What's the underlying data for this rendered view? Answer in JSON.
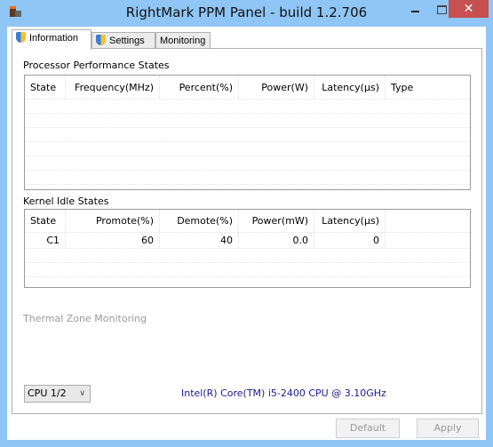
{
  "window": {
    "title": "RightMark PPM Panel - build 1.2.706",
    "close_glyph": "✕"
  },
  "tabs": [
    {
      "label": "Information",
      "icon": "shield-icon"
    },
    {
      "label": "Settings",
      "icon": "shield-icon"
    },
    {
      "label": "Monitoring"
    }
  ],
  "pps": {
    "title": "Processor Performance States",
    "columns": [
      "State",
      "Frequency(MHz)",
      "Percent(%)",
      "Power(W)",
      "Latency(µs)",
      "Type"
    ]
  },
  "kis": {
    "title": "Kernel Idle States",
    "columns": [
      "State",
      "Promote(%)",
      "Demote(%)",
      "Power(mW)",
      "Latency(µs)",
      ""
    ],
    "rows": [
      [
        "C1",
        "60",
        "40",
        "0.0",
        "0",
        ""
      ]
    ]
  },
  "thermal": {
    "title": "Thermal Zone Monitoring"
  },
  "cpu_select": {
    "value": "CPU 1/2"
  },
  "cpu_name": "Intel(R) Core(TM) i5-2400 CPU @ 3.10GHz",
  "buttons": {
    "default": "Default",
    "apply": "Apply"
  }
}
